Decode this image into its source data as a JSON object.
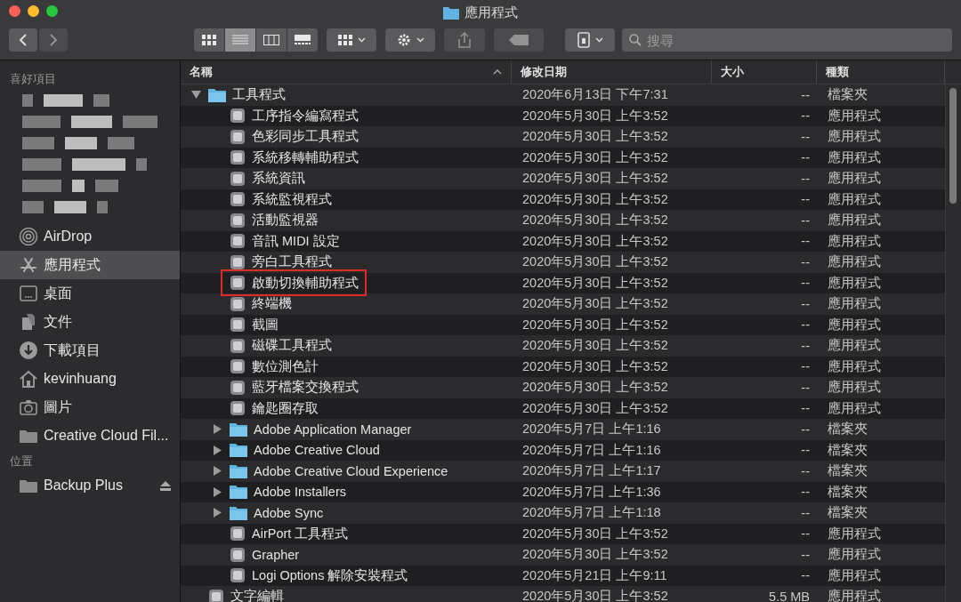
{
  "window": {
    "title": "應用程式"
  },
  "toolbar": {
    "view_modes": [
      {
        "kind": "icons",
        "selected": false
      },
      {
        "kind": "list",
        "selected": true
      },
      {
        "kind": "columns",
        "selected": false
      },
      {
        "kind": "gallery",
        "selected": false
      }
    ],
    "share_disabled": true,
    "tags_disabled": true,
    "search": {
      "placeholder": "搜尋"
    }
  },
  "sidebar": {
    "sections": [
      {
        "title": "喜好項目",
        "items": [
          {
            "label": "AirDrop",
            "kind": "airdrop",
            "selected": false
          },
          {
            "label": "應用程式",
            "kind": "apps",
            "selected": true
          },
          {
            "label": "桌面",
            "kind": "desktop",
            "selected": false
          },
          {
            "label": "文件",
            "kind": "document",
            "selected": false
          },
          {
            "label": "下載項目",
            "kind": "download",
            "selected": false
          },
          {
            "label": "kevinhuang",
            "kind": "home",
            "selected": false
          },
          {
            "label": "圖片",
            "kind": "camera",
            "selected": false
          },
          {
            "label": "Creative Cloud Fil...",
            "kind": "folder",
            "selected": false
          }
        ]
      },
      {
        "title": "位置",
        "items": [
          {
            "label": "Backup Plus",
            "kind": "folder",
            "selected": false,
            "eject": true
          }
        ]
      }
    ]
  },
  "table": {
    "columns": [
      {
        "label": "名稱",
        "sorted": true
      },
      {
        "label": "修改日期",
        "sorted": false
      },
      {
        "label": "大小",
        "sorted": false
      },
      {
        "label": "種類",
        "sorted": false
      }
    ],
    "rows": [
      {
        "name": "工具程式",
        "kind": "folder",
        "expanded": true,
        "highlighted": false,
        "date": "2020年6月13日 下午7:31",
        "size": "--",
        "type": "檔案夾",
        "children": [
          {
            "name": "工序指令編寫程式",
            "kind": "app",
            "highlighted": false,
            "date": "2020年5月30日 上午3:52",
            "size": "--",
            "type": "應用程式"
          },
          {
            "name": "色彩同步工具程式",
            "kind": "app",
            "highlighted": false,
            "date": "2020年5月30日 上午3:52",
            "size": "--",
            "type": "應用程式"
          },
          {
            "name": "系統移轉輔助程式",
            "kind": "app",
            "highlighted": false,
            "date": "2020年5月30日 上午3:52",
            "size": "--",
            "type": "應用程式"
          },
          {
            "name": "系統資訊",
            "kind": "app",
            "highlighted": false,
            "date": "2020年5月30日 上午3:52",
            "size": "--",
            "type": "應用程式"
          },
          {
            "name": "系統監視程式",
            "kind": "app",
            "highlighted": false,
            "date": "2020年5月30日 上午3:52",
            "size": "--",
            "type": "應用程式"
          },
          {
            "name": "活動監視器",
            "kind": "app",
            "highlighted": false,
            "date": "2020年5月30日 上午3:52",
            "size": "--",
            "type": "應用程式"
          },
          {
            "name": "音訊 MIDI 設定",
            "kind": "app",
            "highlighted": false,
            "date": "2020年5月30日 上午3:52",
            "size": "--",
            "type": "應用程式"
          },
          {
            "name": "旁白工具程式",
            "kind": "app",
            "highlighted": false,
            "date": "2020年5月30日 上午3:52",
            "size": "--",
            "type": "應用程式"
          },
          {
            "name": "啟動切換輔助程式",
            "kind": "app",
            "highlighted": true,
            "date": "2020年5月30日 上午3:52",
            "size": "--",
            "type": "應用程式"
          },
          {
            "name": "終端機",
            "kind": "app",
            "highlighted": false,
            "date": "2020年5月30日 上午3:52",
            "size": "--",
            "type": "應用程式"
          },
          {
            "name": "截圖",
            "kind": "app",
            "highlighted": false,
            "date": "2020年5月30日 上午3:52",
            "size": "--",
            "type": "應用程式"
          },
          {
            "name": "磁碟工具程式",
            "kind": "app",
            "highlighted": false,
            "date": "2020年5月30日 上午3:52",
            "size": "--",
            "type": "應用程式"
          },
          {
            "name": "數位測色計",
            "kind": "app",
            "highlighted": false,
            "date": "2020年5月30日 上午3:52",
            "size": "--",
            "type": "應用程式"
          },
          {
            "name": "藍牙檔案交換程式",
            "kind": "app",
            "highlighted": false,
            "date": "2020年5月30日 上午3:52",
            "size": "--",
            "type": "應用程式"
          },
          {
            "name": "鑰匙圈存取",
            "kind": "app",
            "highlighted": false,
            "date": "2020年5月30日 上午3:52",
            "size": "--",
            "type": "應用程式"
          },
          {
            "name": "Adobe Application Manager",
            "kind": "folder",
            "expanded": false,
            "highlighted": false,
            "date": "2020年5月7日 上午1:16",
            "size": "--",
            "type": "檔案夾"
          },
          {
            "name": "Adobe Creative Cloud",
            "kind": "folder",
            "expanded": false,
            "highlighted": false,
            "date": "2020年5月7日 上午1:16",
            "size": "--",
            "type": "檔案夾"
          },
          {
            "name": "Adobe Creative Cloud Experience",
            "kind": "folder",
            "expanded": false,
            "highlighted": false,
            "date": "2020年5月7日 上午1:17",
            "size": "--",
            "type": "檔案夾"
          },
          {
            "name": "Adobe Installers",
            "kind": "folder",
            "expanded": false,
            "highlighted": false,
            "date": "2020年5月7日 上午1:36",
            "size": "--",
            "type": "檔案夾"
          },
          {
            "name": "Adobe Sync",
            "kind": "folder",
            "expanded": false,
            "highlighted": false,
            "date": "2020年5月7日 上午1:18",
            "size": "--",
            "type": "檔案夾"
          },
          {
            "name": "AirPort 工具程式",
            "kind": "app",
            "highlighted": false,
            "date": "2020年5月30日 上午3:52",
            "size": "--",
            "type": "應用程式"
          },
          {
            "name": "Grapher",
            "kind": "app",
            "highlighted": false,
            "date": "2020年5月30日 上午3:52",
            "size": "--",
            "type": "應用程式"
          },
          {
            "name": "Logi Options 解除安裝程式",
            "kind": "app",
            "highlighted": false,
            "date": "2020年5月21日 上午9:11",
            "size": "--",
            "type": "應用程式"
          }
        ]
      },
      {
        "name": "文字編輯",
        "kind": "app",
        "highlighted": false,
        "date": "2020年5月30日 上午3:52",
        "size": "5.5 MB",
        "type": "應用程式"
      }
    ]
  }
}
